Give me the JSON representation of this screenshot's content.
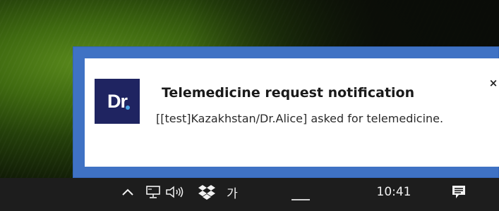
{
  "notification": {
    "app_icon": "dr-app-logo",
    "logo_text": "Dr",
    "title": "Telemedicine request notification",
    "body": "[[test]Kazakhstan/Dr.Alice] asked for telemedicine.",
    "close_label": "×",
    "accent_color": "#3f72c4",
    "logo_color": "#1f2461"
  },
  "taskbar": {
    "tray_icons": [
      "chevron-up-icon",
      "network-icon",
      "speaker-icon",
      "dropbox-icon"
    ],
    "input_method_label": "가",
    "clock": "10:41",
    "action_center_icon": "action-center-icon"
  }
}
